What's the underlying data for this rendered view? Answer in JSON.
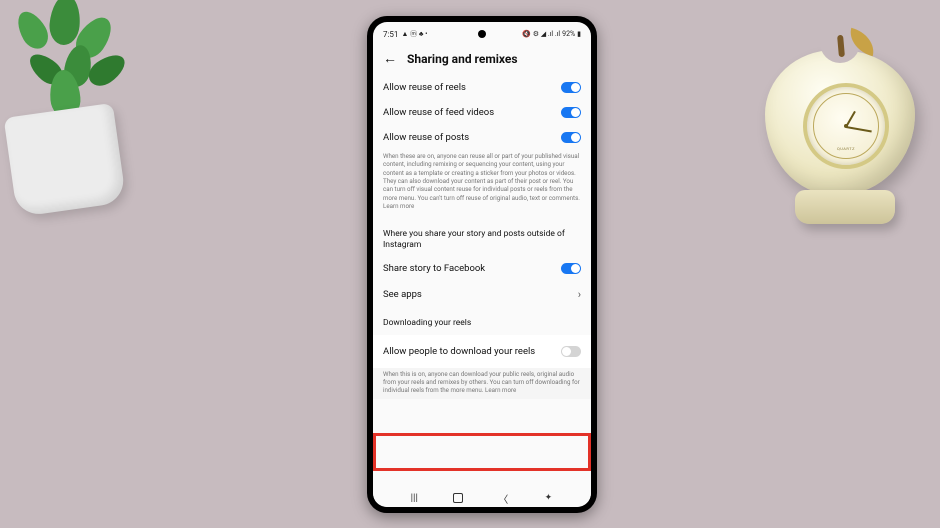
{
  "status": {
    "time": "7:51",
    "icons_left": "▲ ⓜ ♣ •",
    "icons_right": "🔇 ⚙ ◢ .ıl .ıl",
    "battery": "92%"
  },
  "header": {
    "title": "Sharing and remixes"
  },
  "reuse": {
    "reels": "Allow reuse of reels",
    "feed": "Allow reuse of feed videos",
    "posts": "Allow reuse of posts",
    "desc": "When these are on, anyone can reuse all or part of your published visual content, including remixing or sequencing your content, using your content as a template or creating a sticker from your photos or videos. They can also download your content as part of their post or reel. You can turn off visual content reuse for individual posts or reels from the more menu. You can't turn off reuse of original audio, text or comments. Learn more"
  },
  "sharing": {
    "heading": "Where you share your story and posts outside of Instagram",
    "fb": "Share story to Facebook",
    "apps": "See apps"
  },
  "download": {
    "heading": "Downloading your reels",
    "row": "Allow people to download your reels",
    "desc": "When this is on, anyone can download your public reels, original audio from your reels and remixes by others. You can turn off downloading for individual reels from the more menu. Learn more"
  },
  "clock": {
    "brand": "QUARTZ"
  }
}
